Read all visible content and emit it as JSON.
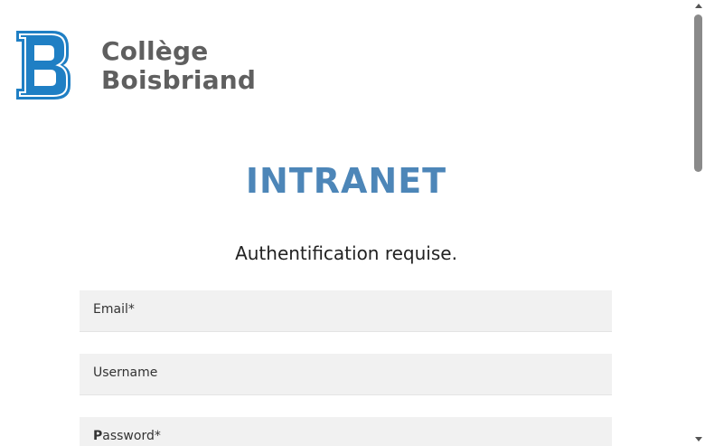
{
  "logo": {
    "line1": "Collège",
    "line2": "Boisbriand",
    "letter": "B",
    "brand_color": "#1f7fc4"
  },
  "title": "INTRANET",
  "subtitle": "Authentification requise.",
  "form": {
    "email_label": "Email*",
    "username_label": "Username",
    "password_label_first": "P",
    "password_label_rest": "assword*"
  },
  "colors": {
    "title": "#4d86b8",
    "field_bg": "#f1f1f1"
  }
}
